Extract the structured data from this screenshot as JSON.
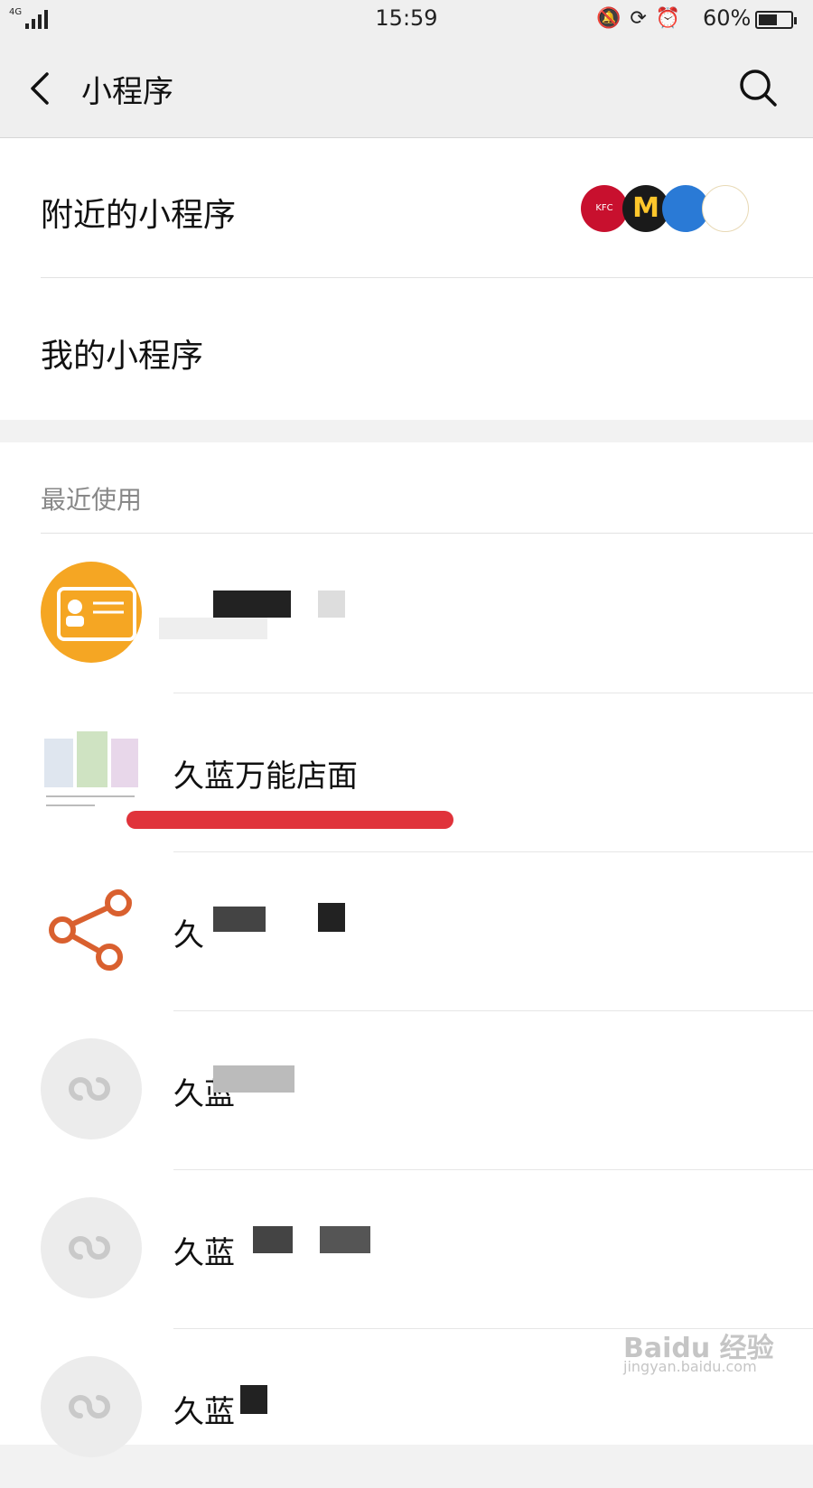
{
  "status_bar": {
    "network": "4G",
    "time": "15:59",
    "battery": "60%",
    "battery_level": 0.6,
    "icons": [
      "mute-icon",
      "rotation-lock-icon",
      "alarm-icon"
    ]
  },
  "nav": {
    "title": "小程序",
    "back_icon": "back-arrow-icon",
    "search_icon": "search-icon"
  },
  "section_a": {
    "nearby_label": "附近的小程序",
    "nearby_logos": [
      {
        "name": "KFC",
        "color": "#c8102e"
      },
      {
        "name": "M",
        "color": "#1a1a1a"
      },
      {
        "name": "",
        "color": "#2a7ad6"
      },
      {
        "name": "",
        "color": "#ffffff"
      }
    ],
    "mine_label": "我的小程序"
  },
  "recent": {
    "header": "最近使用",
    "items": [
      {
        "name": "",
        "icon": "business-card-icon",
        "icon_color": "#f5a623"
      },
      {
        "name": "久蓝万能店面",
        "icon": "storefront-thumbnail-icon",
        "icon_color": "#ffffff"
      },
      {
        "name": "久",
        "icon": "share-icon",
        "icon_color": "#ffffff"
      },
      {
        "name": "久蓝",
        "icon": "mini-program-link-icon",
        "icon_color": "#ececec"
      },
      {
        "name": "久蓝",
        "icon": "mini-program-link-icon",
        "icon_color": "#ececec"
      },
      {
        "name": "久蓝",
        "icon": "mini-program-link-icon",
        "icon_color": "#ececec"
      }
    ]
  },
  "watermark": {
    "brand": "Baidu 经验",
    "url": "jingyan.baidu.com"
  },
  "colors": {
    "accent_underline": "#e0333b",
    "card_orange": "#f5a623",
    "share_orange": "#d9602f"
  }
}
